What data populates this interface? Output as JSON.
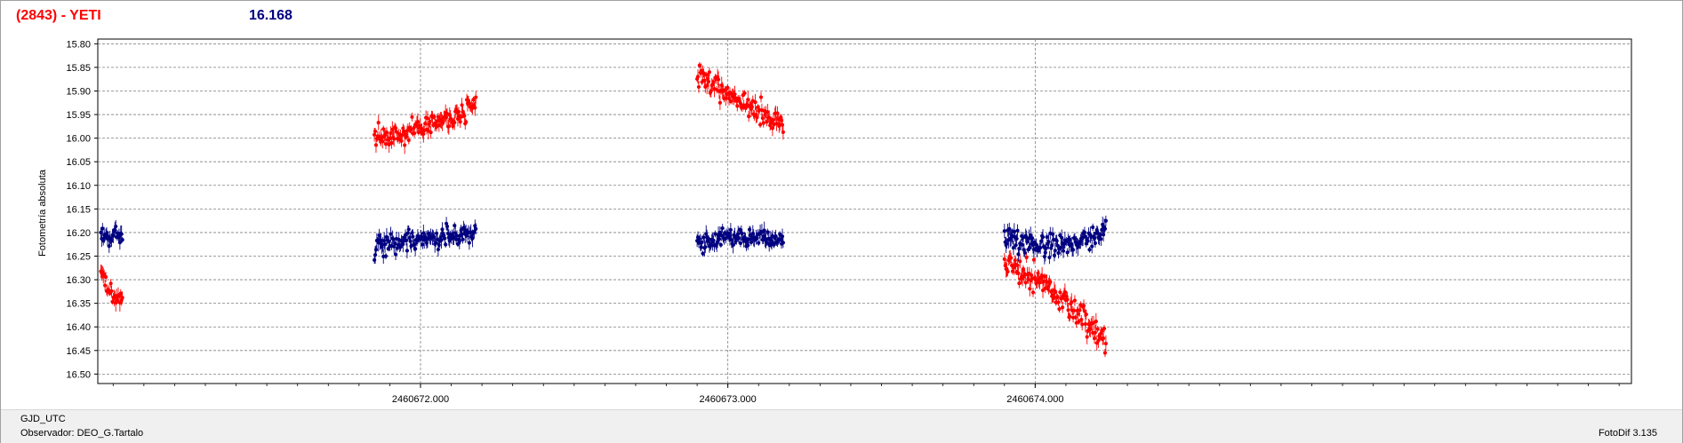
{
  "header": {
    "object_label": "(2843) - YETI",
    "magnitude_value": "16.168"
  },
  "footer": {
    "x_label": "GJD_UTC",
    "observer": "Observador: DEO_G.Tartalo",
    "software": "FotoDif 3.135"
  },
  "colors": {
    "series_red": "#ff0000",
    "series_blue": "#000080",
    "grid": "#808080"
  },
  "chart_data": {
    "type": "scatter",
    "ylabel": "Fotometría absoluta",
    "xlabel": "GJD_UTC",
    "y_inverted": true,
    "ylim": [
      15.79,
      16.52
    ],
    "xlim": [
      2460670.95,
      2460675.94
    ],
    "yticks": [
      "15.80",
      "15.85",
      "15.90",
      "15.95",
      "16.00",
      "16.05",
      "16.10",
      "16.15",
      "16.20",
      "16.25",
      "16.30",
      "16.35",
      "16.40",
      "16.45",
      "16.50"
    ],
    "xticks": [
      "2460672.000",
      "2460673.000",
      "2460674.000"
    ],
    "grid": true,
    "series": [
      {
        "color": "#ff0000",
        "segments": [
          {
            "x_start": 2460670.96,
            "x_end": 2460671.03,
            "y_start": 16.27,
            "y_end": 16.33,
            "y_mid": 16.33,
            "noise": 0.012
          },
          {
            "x_start": 2460671.85,
            "x_end": 2460672.18,
            "y_start": 16.0,
            "y_end": 15.93,
            "y_mid": 15.975,
            "noise": 0.012
          },
          {
            "x_start": 2460672.9,
            "x_end": 2460673.18,
            "y_start": 15.87,
            "y_end": 15.98,
            "y_mid": 15.92,
            "noise": 0.012
          },
          {
            "x_start": 2460673.9,
            "x_end": 2460674.23,
            "y_start": 16.26,
            "y_end": 16.43,
            "y_mid": 16.33,
            "noise": 0.015
          }
        ]
      },
      {
        "color": "#000080",
        "segments": [
          {
            "x_start": 2460670.96,
            "x_end": 2460671.03,
            "y_start": 16.21,
            "y_end": 16.21,
            "y_mid": 16.21,
            "noise": 0.01
          },
          {
            "x_start": 2460671.85,
            "x_end": 2460672.18,
            "y_start": 16.23,
            "y_end": 16.2,
            "y_mid": 16.21,
            "noise": 0.012
          },
          {
            "x_start": 2460672.9,
            "x_end": 2460673.18,
            "y_start": 16.22,
            "y_end": 16.22,
            "y_mid": 16.21,
            "noise": 0.01
          },
          {
            "x_start": 2460673.9,
            "x_end": 2460674.23,
            "y_start": 16.21,
            "y_end": 16.2,
            "y_mid": 16.225,
            "noise": 0.012
          }
        ]
      }
    ]
  }
}
